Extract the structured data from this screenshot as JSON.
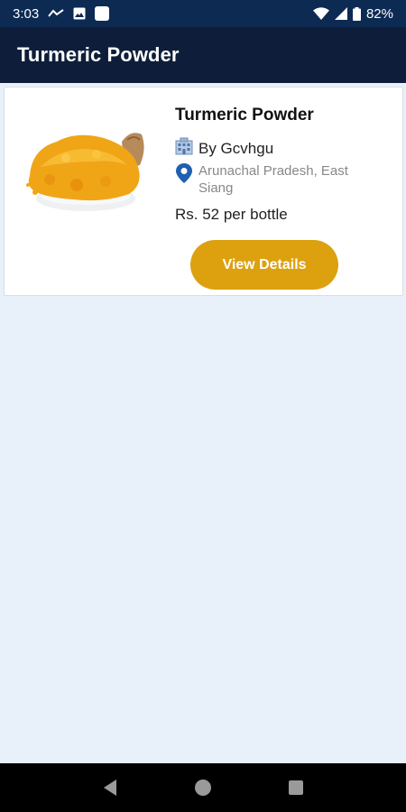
{
  "status_bar": {
    "time": "3:03",
    "battery": "82%",
    "icons": [
      "sim-activity-icon",
      "photo-notification-icon",
      "app-notification-icon",
      "wifi-icon",
      "cell-signal-icon",
      "battery-icon"
    ]
  },
  "app_bar": {
    "title": "Turmeric Powder"
  },
  "products": [
    {
      "name": "Turmeric Powder",
      "seller": "By Gcvhgu",
      "location": "Arunachal Pradesh, East Siang",
      "price": "Rs. 52 per bottle",
      "button_label": "View Details",
      "image": "turmeric-powder-image"
    }
  ],
  "nav_bar": {
    "buttons": [
      "back-icon",
      "home-icon",
      "recents-icon"
    ]
  },
  "colors": {
    "status_bar": "#0c2a52",
    "app_bar": "#0e1e3a",
    "background": "#e8f0fa",
    "button": "#dda10f",
    "location_pin": "#1f5fb0"
  }
}
